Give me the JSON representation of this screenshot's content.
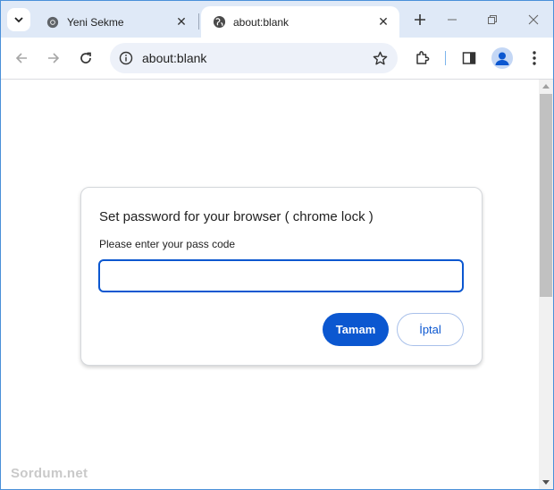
{
  "tabs": [
    {
      "title": "Yeni Sekme",
      "icon": "chrome-icon",
      "active": false
    },
    {
      "title": "about:blank",
      "icon": "globe-icon",
      "active": true
    }
  ],
  "toolbar": {
    "url": "about:blank"
  },
  "dialog": {
    "title": "Set password for your browser ( chrome lock )",
    "label": "Please enter your pass code",
    "input_value": "",
    "ok_label": "Tamam",
    "cancel_label": "İptal"
  },
  "watermark": "Sordum.net",
  "colors": {
    "accent": "#0b57d0",
    "tabstrip": "#dfe9f7",
    "omnibox": "#edf1f9"
  }
}
